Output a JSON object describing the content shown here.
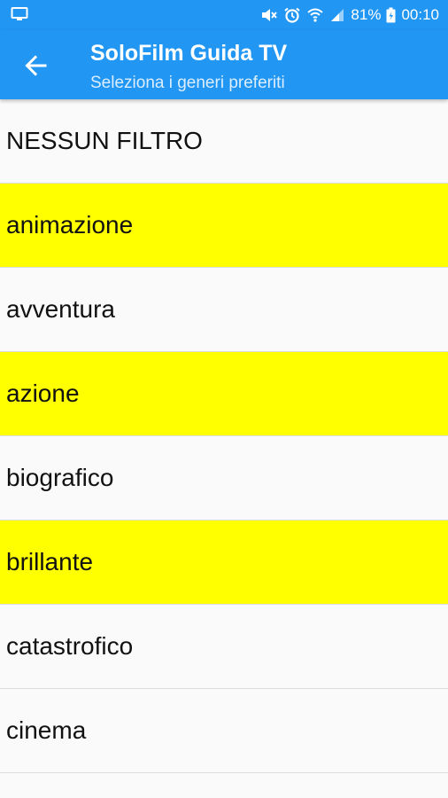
{
  "status_bar": {
    "battery": "81%",
    "time": "00:10",
    "icons": [
      "screen-icon",
      "mute-icon",
      "alarm-icon",
      "wifi-icon",
      "signal-icon",
      "battery-icon"
    ]
  },
  "app_bar": {
    "title": "SoloFilm Guida TV",
    "subtitle": "Seleziona i generi preferiti",
    "back_icon": "back-arrow-icon"
  },
  "colors": {
    "primary": "#2196f3",
    "selected": "#ffff00",
    "background": "#fafafa"
  },
  "genres": [
    {
      "label": "NESSUN FILTRO",
      "selected": false
    },
    {
      "label": "animazione",
      "selected": true
    },
    {
      "label": "avventura",
      "selected": false
    },
    {
      "label": "azione",
      "selected": true
    },
    {
      "label": "biografico",
      "selected": false
    },
    {
      "label": "brillante",
      "selected": true
    },
    {
      "label": "catastrofico",
      "selected": false
    },
    {
      "label": "cinema",
      "selected": false
    }
  ]
}
